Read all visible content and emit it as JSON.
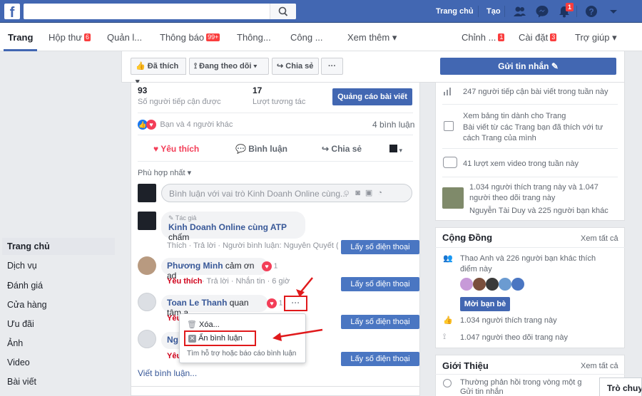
{
  "topbar": {
    "logo": "f",
    "home": "Trang chủ",
    "create": "Tạo",
    "notif_count": "1"
  },
  "pagenav": {
    "items": [
      {
        "label": "Trang"
      },
      {
        "label": "Hộp thư",
        "badge": "6"
      },
      {
        "label": "Quản l..."
      },
      {
        "label": "Thông báo",
        "badge": "99+"
      },
      {
        "label": "Thông..."
      },
      {
        "label": "Công ..."
      },
      {
        "label": "Xem thêm ▾"
      },
      {
        "label": "Chỉnh ...",
        "badge": "1"
      },
      {
        "label": "Cài đặt",
        "badge": "3"
      },
      {
        "label": "Trợ giúp ▾"
      }
    ]
  },
  "left": {
    "items": [
      "Trang chủ",
      "Dịch vụ",
      "Đánh giá",
      "Cửa hàng",
      "Ưu đãi",
      "Ảnh",
      "Video",
      "Bài viết"
    ]
  },
  "actionbar": {
    "liked": "Đã thích",
    "following": "Đang theo dõi",
    "share": "Chia sẻ",
    "more": "···",
    "send_message": "Gửi tin nhắn"
  },
  "stats": {
    "reach_value": "93",
    "reach_label": "Số người tiếp cận được",
    "engage_value": "17",
    "engage_label": "Lượt tương tác",
    "boost": "Quảng cáo bài viết"
  },
  "reactions": {
    "summary": "Bạn và 4 người khác",
    "comments": "4 bình luận"
  },
  "post_actions": {
    "love": "Yêu thích",
    "comment": "Bình luận",
    "share": "Chia sẻ"
  },
  "sort": "Phù hợp nhất ▾",
  "composer_placeholder": "Bình luận với vai trò Kinh Doanh Online cùng...",
  "comments": [
    {
      "author_tag": "Tác giả",
      "name": "Kinh Doanh Online cùng ATP",
      "text": "chấm",
      "meta": "Thích · Trả lời · Người bình luận: Nguyễn Quyết (?... · 6 giờ",
      "phone_btn": "Lấy số điện thoại"
    },
    {
      "name": "Phương Minh",
      "text": "cảm ơn ad",
      "react_count": "1",
      "love": "Yêu thích",
      "meta": "· Trả lời · Nhắn tin · 6 giờ",
      "phone_btn": "Lấy số điện thoại"
    },
    {
      "name": "Toan Le Thanh",
      "text": "quan tâm ạ",
      "react_count": "1",
      "love": "Yêu",
      "more": "···",
      "phone_btn": "Lấy số điện thoại"
    },
    {
      "name": "Ng",
      "love": "Yêu",
      "phone_btn": "Lấy số điện thoại"
    }
  ],
  "write_comment": "Viết bình luận...",
  "menu": {
    "delete": "Xóa...",
    "hide": "Ẩn bình luận",
    "help": "Tìm hỗ trợ hoặc báo cáo bình luận"
  },
  "right": {
    "insight1": "247 người tiếp cận bài viết trong tuần này",
    "insight2a": "Xem bảng tin dành cho Trang",
    "insight2b": "Bài viết từ các Trang bạn đã thích với tư cách Trang của mình",
    "insight3": "41 lượt xem video trong tuần này",
    "insight4a": "1.034 người thích trang này và 1.047 người theo dõi trang này",
    "insight4b": "Nguyễn Tài Duy và 225 người bạn khác",
    "community_title": "Cộng Đồng",
    "see_all": "Xem tất cả",
    "friends_like": "Thao Anh và 226 người bạn khác thích điểm này",
    "invite": "Mời bạn bè",
    "likes_total": "1.034 người thích trang này",
    "follows_total": "1.047 người theo dõi trang này",
    "about_title": "Giới Thiệu",
    "edit": "Xem tất cả",
    "response": "Thường phản hồi trong vòng một giờ",
    "send_msg": "Gửi tin nhắn",
    "chat": "Trò chuyện"
  },
  "colors": {
    "brand": "#4267b2",
    "love": "#f33e58",
    "annotation": "#e0191b"
  }
}
